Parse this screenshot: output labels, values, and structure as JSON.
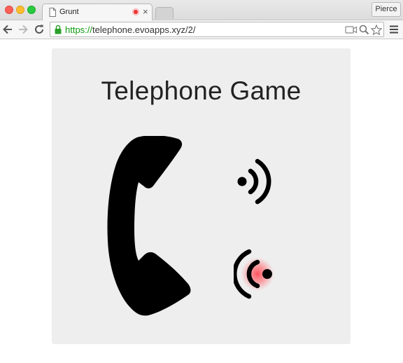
{
  "browser": {
    "tab": {
      "title": "Grunt"
    },
    "profile": {
      "label": "Pierce"
    },
    "address": {
      "scheme": "https://",
      "rest": "telephone.evoapps.xyz/2/"
    }
  },
  "page": {
    "title": "Telephone Game"
  },
  "colors": {
    "card_background": "#eeeeee",
    "icon": "#000000",
    "recording_glow": "#ff4b55",
    "secure_url": "#109a10"
  }
}
